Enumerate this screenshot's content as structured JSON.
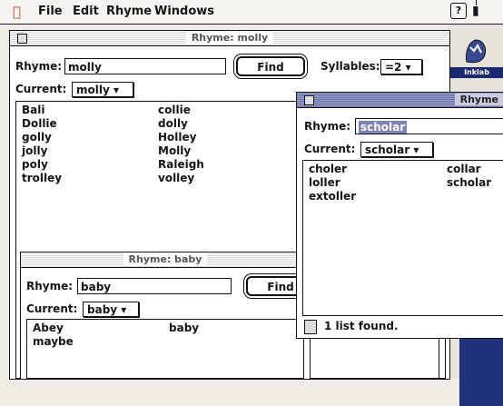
{
  "menubar": {
    "items": [
      "File",
      "Edit",
      "Rhyme",
      "Windows"
    ]
  },
  "desktop": {
    "icon_label": "Inklab"
  },
  "win_molly": {
    "title": "Rhyme: molly",
    "rhyme_label": "Rhyme:",
    "rhyme_value": "molly",
    "find_label": "Find",
    "syllables_label": "Syllables:",
    "syllables_value": "=2 ▾",
    "current_label": "Current:",
    "current_value": "molly ▾",
    "col1": [
      "Bali",
      "Dollie",
      "golly",
      "jolly",
      "poly",
      "trolley"
    ],
    "col2": [
      "collie",
      "dolly",
      "Holley",
      "Molly",
      "Raleigh",
      "volley"
    ]
  },
  "win_baby": {
    "title": "Rhyme: baby",
    "rhyme_label": "Rhyme:",
    "rhyme_value": "baby",
    "find_label": "Find",
    "current_label": "Current:",
    "current_value": "baby ▾",
    "col1": [
      "Abey",
      "maybe"
    ],
    "col2": [
      "baby"
    ]
  },
  "win_scholar": {
    "title": "Rhyme",
    "rhyme_label": "Rhyme:",
    "rhyme_value": "scholar",
    "current_label": "Current:",
    "current_value": "scholar ▾",
    "col1": [
      "choler",
      "loller",
      "extoller"
    ],
    "col2": [
      "collar",
      "scholar"
    ],
    "status": "1 list found."
  },
  "colors": {
    "accent": "#7d83b9",
    "desktop_blue": "#21327a"
  }
}
